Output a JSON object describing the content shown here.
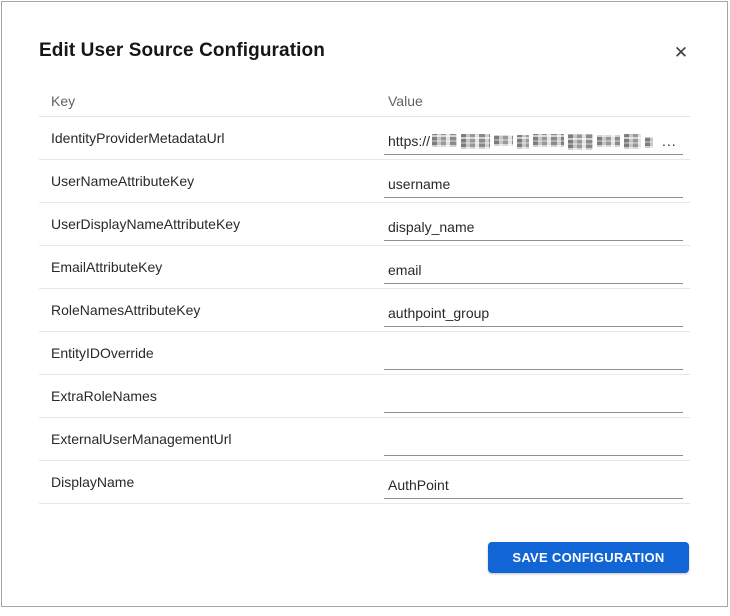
{
  "dialog": {
    "title": "Edit User Source Configuration",
    "close_glyph": "✕"
  },
  "table": {
    "headers": {
      "key": "Key",
      "value": "Value"
    },
    "rows": [
      {
        "key": "IdentityProviderMetadataUrl",
        "value_prefix": "https://",
        "value_redacted": true,
        "value_suffix": "..."
      },
      {
        "key": "UserNameAttributeKey",
        "value": "username"
      },
      {
        "key": "UserDisplayNameAttributeKey",
        "value": "dispaly_name"
      },
      {
        "key": "EmailAttributeKey",
        "value": "email"
      },
      {
        "key": "RoleNamesAttributeKey",
        "value": "authpoint_group"
      },
      {
        "key": "EntityIDOverride",
        "value": ""
      },
      {
        "key": "ExtraRoleNames",
        "value": ""
      },
      {
        "key": "ExternalUserManagementUrl",
        "value": ""
      },
      {
        "key": "DisplayName",
        "value": "AuthPoint"
      }
    ]
  },
  "footer": {
    "save_label": "SAVE CONFIGURATION"
  },
  "colors": {
    "accent_blue": "#1165d4",
    "divider": "#e7e7e7",
    "input_underline": "#8f8f8f",
    "header_text": "#5f6368",
    "body_text": "#27292b"
  }
}
